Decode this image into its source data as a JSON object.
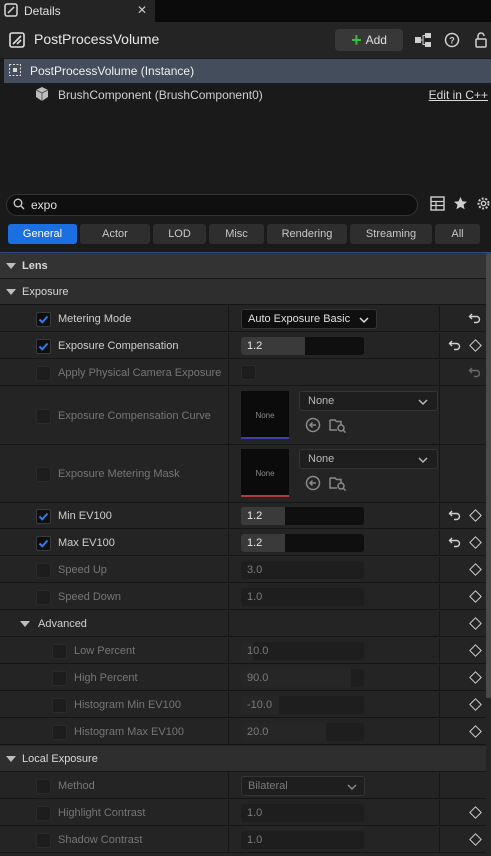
{
  "tab": {
    "title": "Details",
    "close": "✕"
  },
  "header": {
    "title": "PostProcessVolume",
    "add_label": "Add"
  },
  "tree": {
    "items": [
      {
        "label": "PostProcessVolume (Instance)"
      },
      {
        "label": "BrushComponent (BrushComponent0)"
      }
    ],
    "edit_link": "Edit in C++"
  },
  "search": {
    "value": "expo"
  },
  "filters": [
    "General",
    "Actor",
    "LOD",
    "Misc",
    "Rendering",
    "Streaming",
    "All"
  ],
  "categories": {
    "lens": "Lens",
    "exposure": "Exposure",
    "advanced": "Advanced",
    "local_exposure": "Local Exposure"
  },
  "props": {
    "metering_mode": {
      "label": "Metering Mode",
      "value": "Auto Exposure Basic",
      "checked": true
    },
    "exposure_comp": {
      "label": "Exposure Compensation",
      "value": "1.2",
      "checked": true
    },
    "apply_physical": {
      "label": "Apply Physical Camera Exposure",
      "checked": false
    },
    "exposure_curve": {
      "label": "Exposure Compensation Curve",
      "thumb": "None",
      "asset": "None"
    },
    "metering_mask": {
      "label": "Exposure Metering Mask",
      "thumb": "None",
      "asset": "None"
    },
    "min_ev": {
      "label": "Min EV100",
      "value": "1.2",
      "checked": true
    },
    "max_ev": {
      "label": "Max EV100",
      "value": "1.2",
      "checked": true
    },
    "speed_up": {
      "label": "Speed Up",
      "value": "3.0"
    },
    "speed_down": {
      "label": "Speed Down",
      "value": "1.0"
    },
    "low_percent": {
      "label": "Low Percent",
      "value": "10.0"
    },
    "high_percent": {
      "label": "High Percent",
      "value": "90.0"
    },
    "hist_min": {
      "label": "Histogram Min EV100",
      "value": "-10.0"
    },
    "hist_max": {
      "label": "Histogram Max EV100",
      "value": "20.0"
    },
    "method": {
      "label": "Method",
      "value": "Bilateral"
    },
    "highlight_contrast": {
      "label": "Highlight Contrast",
      "value": "1.0"
    },
    "shadow_contrast": {
      "label": "Shadow Contrast",
      "value": "1.0"
    }
  },
  "colors": {
    "accent": "#1c6fe0",
    "selection": "#434d5c",
    "add_plus": "#3fbf3f",
    "curve_line": "#3b3fb0",
    "mask_line": "#b03b3b"
  }
}
